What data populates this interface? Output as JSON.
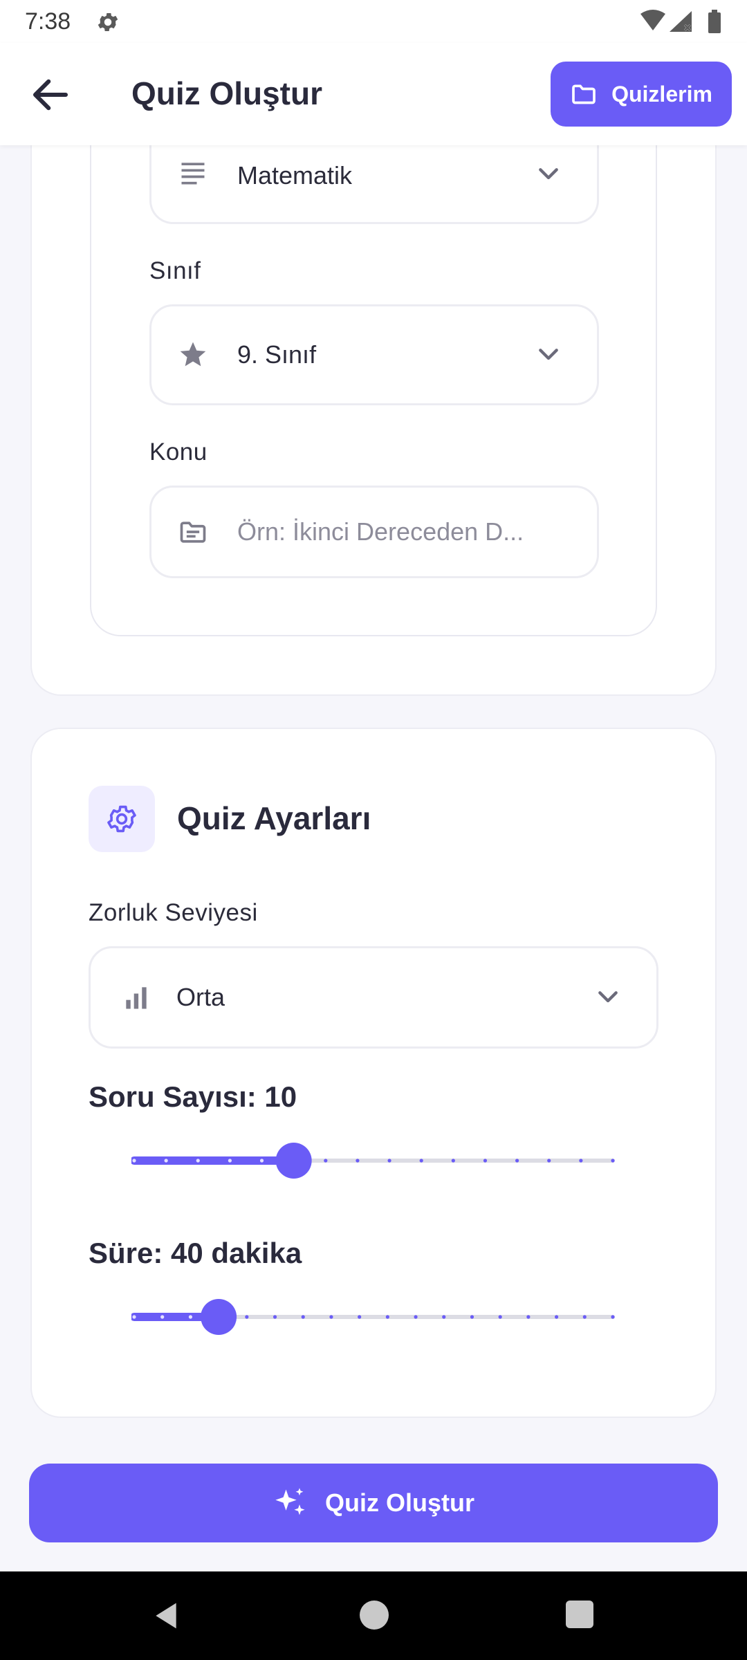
{
  "status_bar": {
    "time": "7:38",
    "icons": [
      "gear-icon",
      "wifi-icon",
      "signal-icon",
      "battery-icon"
    ]
  },
  "app_bar": {
    "title": "Quiz Oluştur",
    "my_quizzes_label": "Quizlerim",
    "icons": [
      "back-arrow-icon",
      "folder-icon"
    ]
  },
  "subject": {
    "value": "Matematik",
    "icon": "list-lines-icon"
  },
  "grade": {
    "label": "Sınıf",
    "value": "9. Sınıf",
    "icon": "star-icon"
  },
  "topic": {
    "label": "Konu",
    "placeholder": "Örn: İkinci Dereceden D...",
    "icon": "folder-note-icon"
  },
  "settings": {
    "title": "Quiz Ayarları",
    "icon": "gear-icon",
    "difficulty": {
      "label": "Zorluk Seviyesi",
      "value": "Orta",
      "icon": "bar-chart-icon"
    },
    "question_count": {
      "label": "Soru Sayısı: 10",
      "value": 10
    },
    "duration": {
      "label": "Süre: 40 dakika",
      "value": 40
    }
  },
  "create_button": {
    "label": "Quiz Oluştur",
    "icon": "sparkles-icon"
  },
  "colors": {
    "accent": "#6a5cf6",
    "accent_light": "#efedff",
    "track": "#dcdce4",
    "text": "#2b2b3a",
    "muted": "#8d8c9a"
  }
}
